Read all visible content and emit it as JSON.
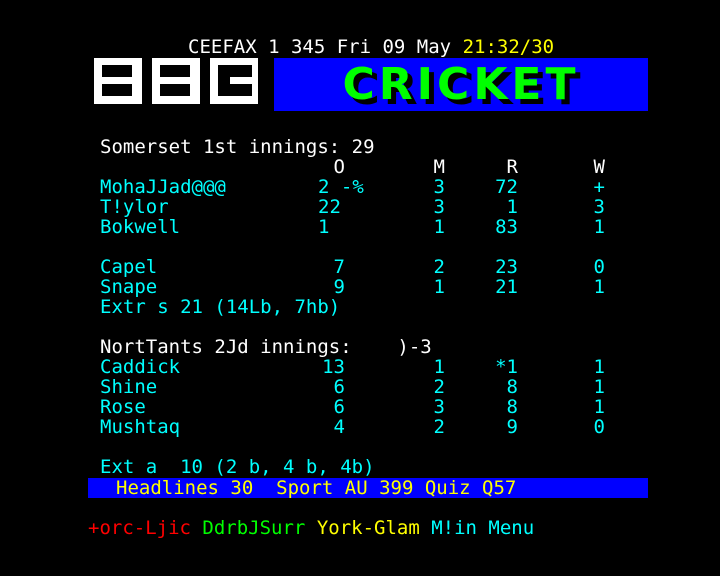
{
  "header": {
    "service": "CEEFAX",
    "page_info": "1 345 Fri 09 May",
    "time": "21:32/30"
  },
  "logo": {
    "letters": [
      "B",
      "B",
      "C"
    ],
    "mark": "R"
  },
  "title": "CRICKET",
  "somerset": {
    "heading": "Somerset 1st innings: 29",
    "columns": {
      "o": "O",
      "m": "M",
      "r": "R",
      "w": "W"
    },
    "bowlers_a": [
      {
        "name": "MohaJJad@@@",
        "o": "2 -%",
        "m": "3",
        "r": "72",
        "w": "+"
      },
      {
        "name": "T!ylor",
        "o": "22",
        "m": "3",
        "r": "1",
        "w": "3"
      },
      {
        "name": "Bokwell",
        "o": "1",
        "m": "1",
        "r": "83",
        "w": "1"
      }
    ],
    "bowlers_b": [
      {
        "name": "Capel",
        "o": "7",
        "m": "2",
        "r": "23",
        "w": "0"
      },
      {
        "name": "Snape",
        "o": "9",
        "m": "1",
        "r": "21",
        "w": "1"
      }
    ],
    "extras": "Extr s 21 (14Lb, 7hb)"
  },
  "northants": {
    "heading": "NortTants 2Jd innings:    )-3",
    "bowlers": [
      {
        "name": "Caddick",
        "o": "13",
        "m": "1",
        "r": "*1",
        "w": "1"
      },
      {
        "name": "Shine",
        "o": "6",
        "m": "2",
        "r": "8",
        "w": "1"
      },
      {
        "name": "Rose",
        "o": "6",
        "m": "3",
        "r": "8",
        "w": "1"
      },
      {
        "name": "Mushtaq",
        "o": "4",
        "m": "2",
        "r": "9",
        "w": "0"
      }
    ],
    "extras": "Ext a  10 (2 b, 4 b, 4b)"
  },
  "nav_bar": "Headlines 30  Sport AU 399 Quiz Q57",
  "fastext": {
    "red": "+orc-Ljic",
    "green": "DdrbJSurr",
    "yellow": "York-Glam",
    "cyan": "M!in Menu"
  },
  "colors": {
    "background": "#000000",
    "title_bar": "#0000ff",
    "title_text": "#00ff00",
    "data_text": "#00ffff",
    "time_text": "#ffff00"
  }
}
